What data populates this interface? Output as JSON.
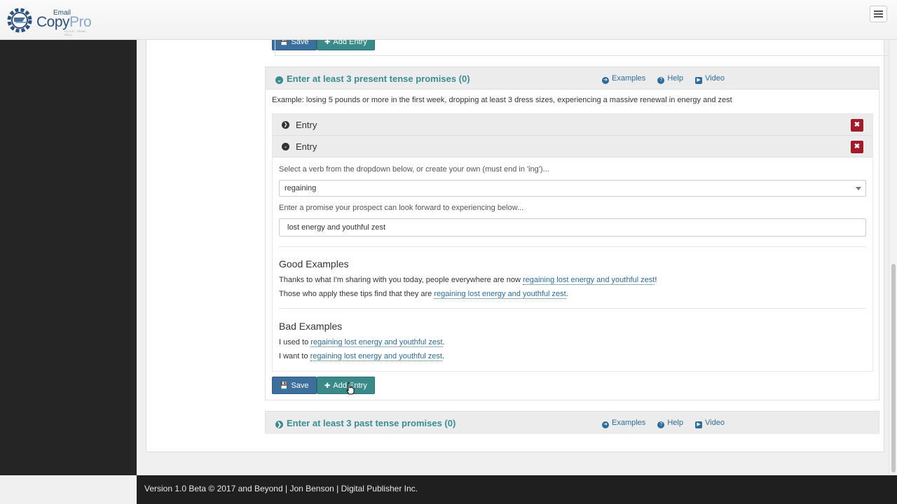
{
  "logo": {
    "email": "Email",
    "copy": "Copy",
    "pro": "Pro",
    "tagline": "CLICK. SEND. SELL."
  },
  "top_buttons": {
    "save": "Save",
    "add_entry": "Add Entry"
  },
  "present_section": {
    "title": "Enter at least 3 present tense promises (0)",
    "links": {
      "examples": "Examples",
      "help": "Help",
      "video": "Video"
    },
    "example": "Example: losing 5 pounds or more in the first week, dropping at least 3 dress sizes, experiencing a massive renewal in energy and zest",
    "entries": [
      {
        "label": "Entry",
        "collapsed": true
      },
      {
        "label": "Entry",
        "collapsed": false
      }
    ],
    "verb_label": "Select a verb from the dropdown below, or create your own (must end in 'ing')...",
    "verb_value": "regaining",
    "promise_label": "Enter a promise your prospect can look forward to experiencing below...",
    "promise_value": "lost energy and youthful zest",
    "good_heading": "Good Examples",
    "good_1_pre": "Thanks to what I'm sharing with you today, people everywhere are now ",
    "good_1_hl": "regaining lost energy and youthful zest",
    "good_1_post": "!",
    "good_2_pre": "Those who apply these tips find that they are ",
    "good_2_hl": "regaining lost energy and youthful zest",
    "good_2_post": ".",
    "bad_heading": "Bad Examples",
    "bad_1_pre": "I used to ",
    "bad_1_hl": "regaining lost energy and youthful zest",
    "bad_1_post": ".",
    "bad_2_pre": "I want to ",
    "bad_2_hl": "regaining lost energy and youthful zest",
    "bad_2_post": ".",
    "save": "Save",
    "add_entry": "Add Entry"
  },
  "past_section": {
    "title": "Enter at least 3 past tense promises (0)",
    "links": {
      "examples": "Examples",
      "help": "Help",
      "video": "Video"
    }
  },
  "footer": "Version 1.0 Beta © 2017 and Beyond | Jon Benson | Digital Publisher Inc.",
  "colors": {
    "teal": "#3a8c94",
    "blue_btn": "#3c6f9e",
    "teal_btn": "#3b8a8a",
    "delete": "#a31a2a",
    "link": "#2b6c9a"
  }
}
